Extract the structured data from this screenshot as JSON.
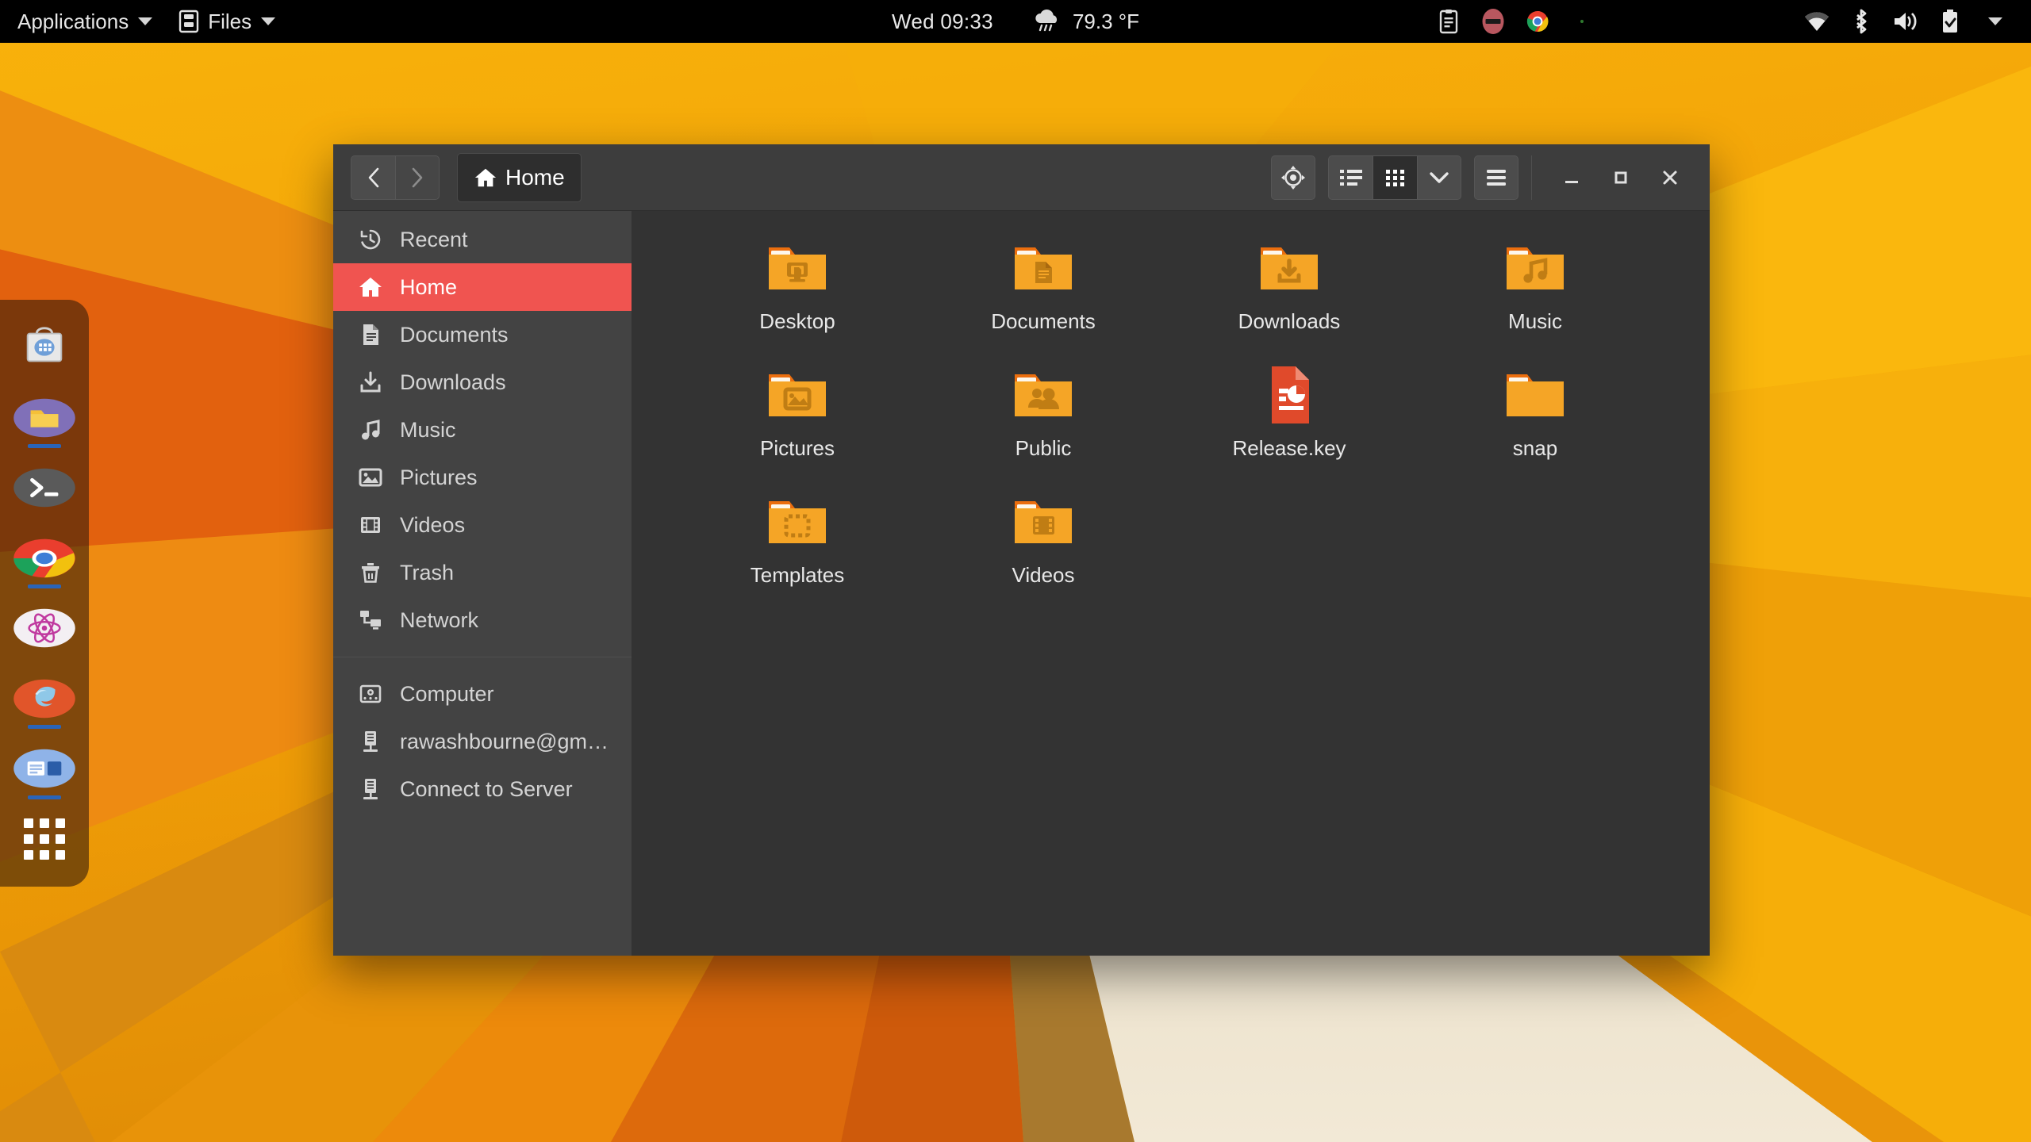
{
  "panel": {
    "applications_label": "Applications",
    "files_label": "Files",
    "clock": "Wed 09:33",
    "weather_temp": "79.3 °F",
    "weather_icon": "rain-cloud-icon",
    "tray": [
      {
        "name": "clipboard-indicator-icon"
      },
      {
        "name": "do-not-disturb-icon"
      },
      {
        "name": "chrome-indicator-icon"
      },
      {
        "name": "small-green-dot-icon"
      },
      {
        "name": "wifi-icon"
      },
      {
        "name": "bluetooth-icon"
      },
      {
        "name": "volume-icon"
      },
      {
        "name": "battery-icon"
      },
      {
        "name": "system-menu-caret-icon"
      }
    ]
  },
  "dock": {
    "items": [
      {
        "name": "software-center-icon",
        "running": false
      },
      {
        "name": "file-manager-icon",
        "running": true
      },
      {
        "name": "terminal-icon",
        "running": false
      },
      {
        "name": "chrome-icon",
        "running": true
      },
      {
        "name": "atom-editor-icon",
        "running": false
      },
      {
        "name": "firefox-icon",
        "running": true
      },
      {
        "name": "help-viewer-icon",
        "running": true
      }
    ],
    "show_apps_label": "Show Applications"
  },
  "window": {
    "title": "Home",
    "back_label": "Back",
    "forward_label": "Forward",
    "path_label": "Home",
    "toolbar": {
      "location_label": "Location",
      "list_view_label": "List view",
      "grid_view_label": "Grid view",
      "view_options_label": "View options",
      "menu_label": "Menu"
    },
    "controls": {
      "minimize_label": "Minimize",
      "maximize_label": "Maximize",
      "close_label": "Close"
    }
  },
  "sidebar": {
    "group_places": [
      {
        "label": "Recent",
        "icon": "history-icon",
        "selected": false
      },
      {
        "label": "Home",
        "icon": "home-icon",
        "selected": true
      },
      {
        "label": "Documents",
        "icon": "document-icon",
        "selected": false
      },
      {
        "label": "Downloads",
        "icon": "download-icon",
        "selected": false
      },
      {
        "label": "Music",
        "icon": "music-note-icon",
        "selected": false
      },
      {
        "label": "Pictures",
        "icon": "picture-icon",
        "selected": false
      },
      {
        "label": "Videos",
        "icon": "film-icon",
        "selected": false
      },
      {
        "label": "Trash",
        "icon": "trash-icon",
        "selected": false
      },
      {
        "label": "Network",
        "icon": "network-icon",
        "selected": false
      }
    ],
    "group_devices": [
      {
        "label": "Computer",
        "icon": "computer-icon",
        "selected": false
      },
      {
        "label": "rawashbourne@gm…",
        "icon": "server-icon",
        "selected": false
      },
      {
        "label": "Connect to Server",
        "icon": "server-icon",
        "selected": false
      }
    ]
  },
  "files": [
    {
      "name": "Desktop",
      "type": "folder",
      "emblem": "desktop-emblem"
    },
    {
      "name": "Documents",
      "type": "folder",
      "emblem": "document-emblem"
    },
    {
      "name": "Downloads",
      "type": "folder",
      "emblem": "download-emblem"
    },
    {
      "name": "Music",
      "type": "folder",
      "emblem": "music-emblem"
    },
    {
      "name": "Pictures",
      "type": "folder",
      "emblem": "picture-emblem"
    },
    {
      "name": "Public",
      "type": "folder",
      "emblem": "people-emblem"
    },
    {
      "name": "Release.key",
      "type": "file",
      "emblem": "presentation-file-icon"
    },
    {
      "name": "snap",
      "type": "folder",
      "emblem": "none"
    },
    {
      "name": "Templates",
      "type": "folder",
      "emblem": "template-emblem"
    },
    {
      "name": "Videos",
      "type": "folder",
      "emblem": "film-emblem"
    }
  ],
  "colors": {
    "accent_red": "#F05450",
    "folder_orange": "#F5A526",
    "folder_tab_orange": "#EB6E0E",
    "window_bg": "#333333",
    "sidebar_bg": "#434343",
    "headerbar_bg": "#3D3D3D",
    "panel_bg": "#000000",
    "wallpaper_base": "#F2A007",
    "file_red": "#E04A2B"
  }
}
